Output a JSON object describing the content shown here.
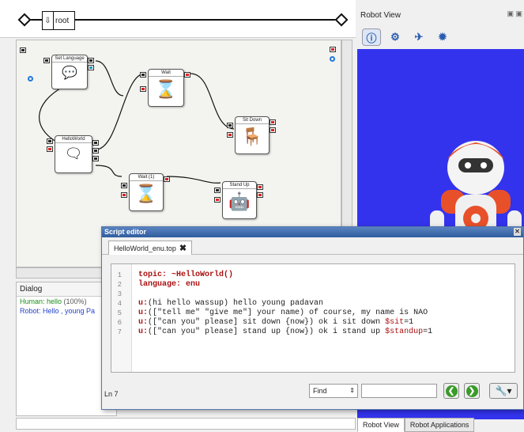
{
  "breadcrumb": {
    "root_label": "root"
  },
  "canvas": {
    "boxes": [
      {
        "id": "setlang",
        "title": "Set Language"
      },
      {
        "id": "wait",
        "title": "Wait"
      },
      {
        "id": "sitdown",
        "title": "Sit Down"
      },
      {
        "id": "helloworld",
        "title": "HelloWorld"
      },
      {
        "id": "wait1",
        "title": "Wait (1)"
      },
      {
        "id": "standup",
        "title": "Stand Up"
      }
    ]
  },
  "dialog": {
    "title": "Dialog",
    "human_prefix": "Human: hello",
    "human_conf": "(100%)",
    "robot_text": "Robot: Hello , young Pa"
  },
  "robot_view": {
    "title": "Robot View",
    "tabs": [
      "Robot View",
      "Robot Applications"
    ],
    "colors": {
      "background": "#3333ee",
      "robot_accent": "#e8502a"
    }
  },
  "script_editor": {
    "title": "Script editor",
    "tab_label": "HelloWorld_enu.top",
    "line_numbers": [
      "1",
      "2",
      "3",
      "4",
      "5",
      "6",
      "7"
    ],
    "lines": [
      "topic: ~HelloWorld()",
      "language: enu",
      "",
      "u:(hi hello wassup) hello young padavan",
      "u:([\"tell me\" \"give me\"] your name) of course, my name is NAO",
      "u:([\"can you\" please] sit down {now}) ok i sit down $sit=1",
      "u:([\"can you\" please] stand up {now}) ok i stand up $standup=1"
    ],
    "status": "Ln 7",
    "find_label": "Find"
  }
}
